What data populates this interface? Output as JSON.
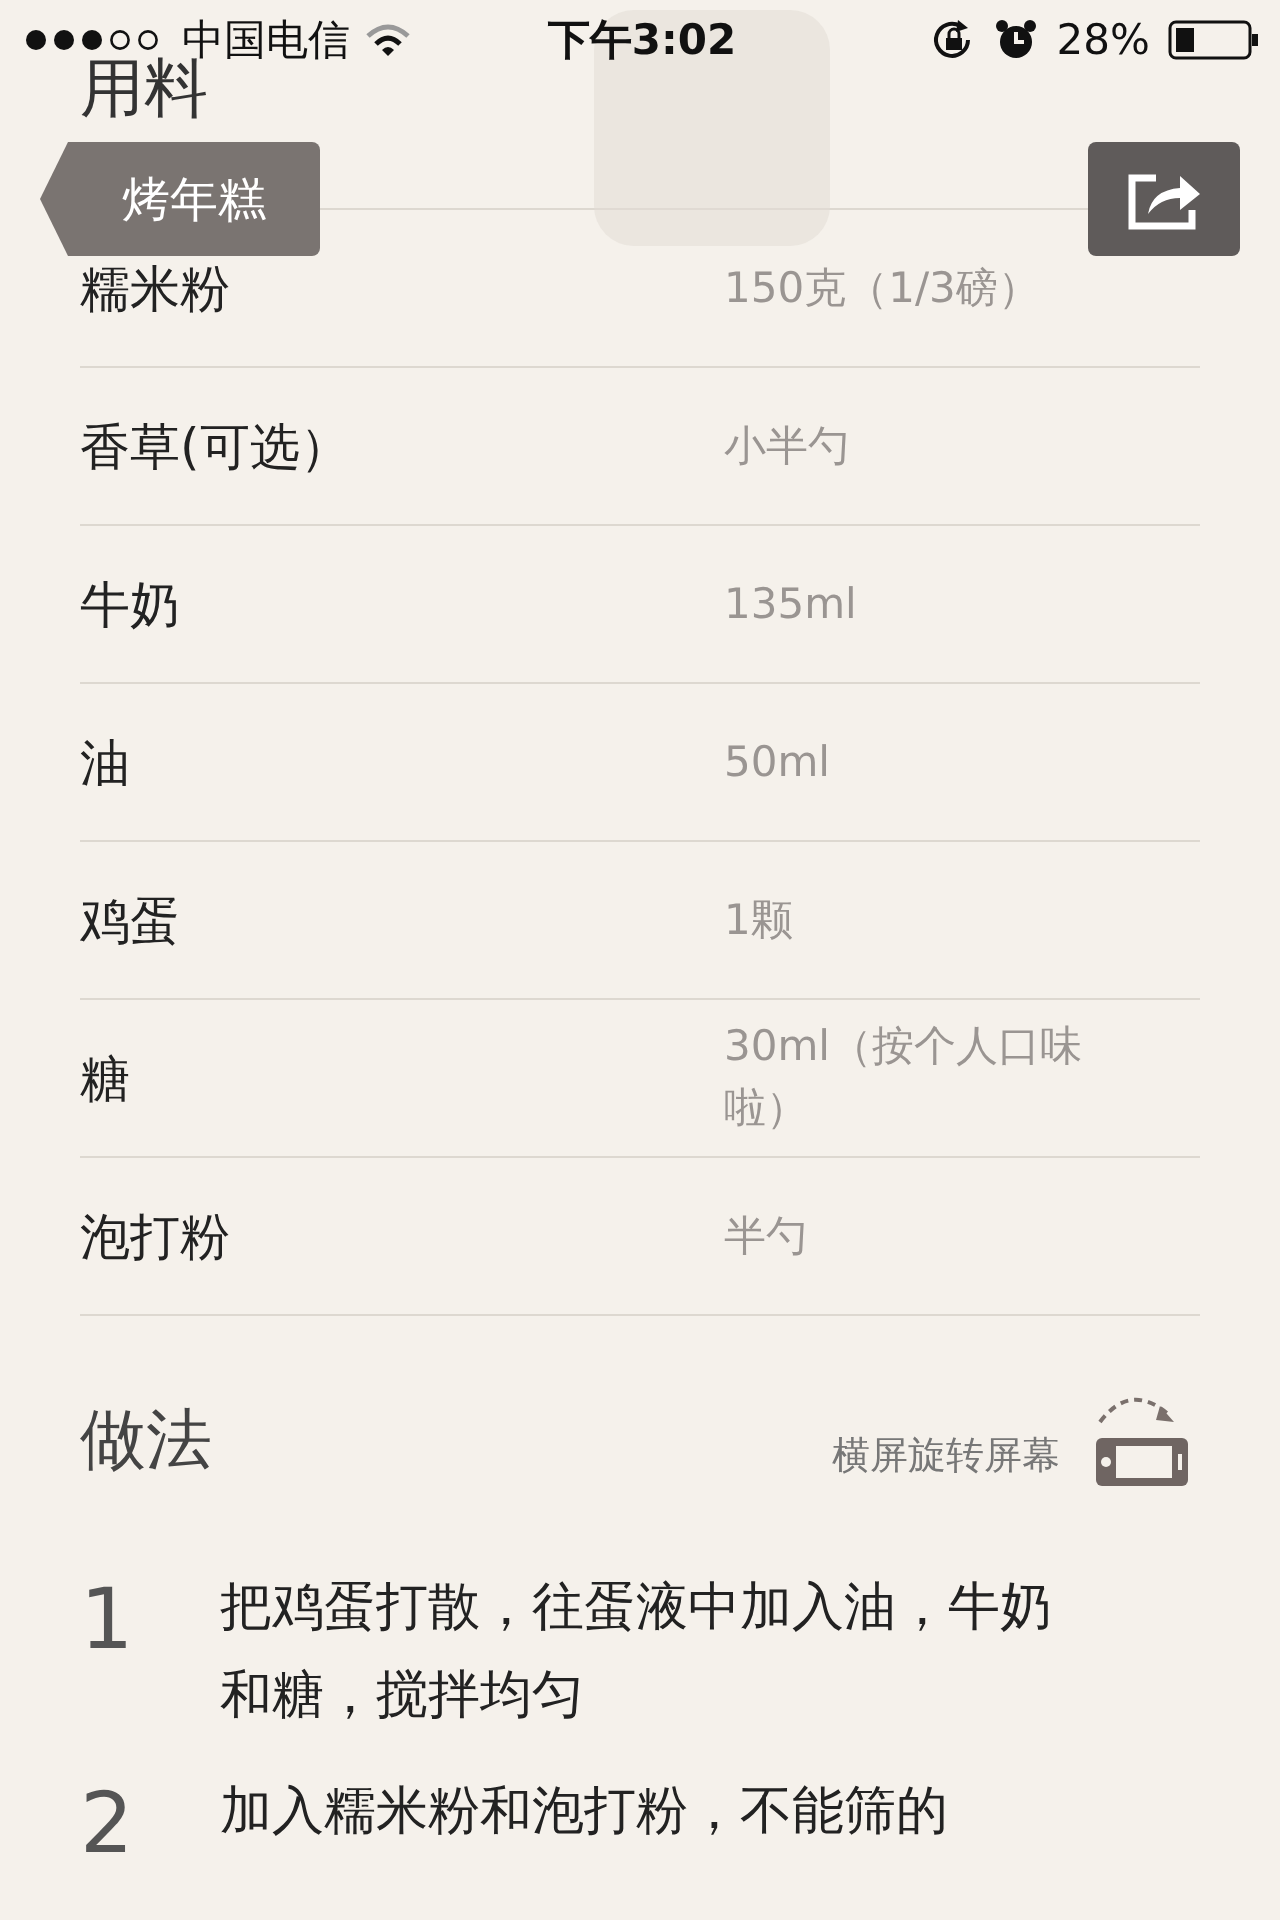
{
  "status_bar": {
    "carrier": "中国电信",
    "time": "下午3:02",
    "battery": "28%"
  },
  "nav": {
    "back": "烤年糕"
  },
  "ingredients": {
    "title": "用料",
    "rows": [
      {
        "name": "糯米粉",
        "amount": "150克（1/3磅）"
      },
      {
        "name": "香草(可选）",
        "amount": "小半勺"
      },
      {
        "name": "牛奶",
        "amount": "135ml"
      },
      {
        "name": "油",
        "amount": "50ml"
      },
      {
        "name": "鸡蛋",
        "amount": "1颗"
      },
      {
        "name": "糖",
        "amount": "30ml（按个人口味啦）"
      },
      {
        "name": "泡打粉",
        "amount": "半勺"
      }
    ]
  },
  "method": {
    "title": "做法",
    "rotate_hint": "横屏旋转屏幕",
    "steps": [
      {
        "number": "1",
        "text": "把鸡蛋打散，往蛋液中加入油，牛奶和糖，搅拌均匀"
      },
      {
        "number": "2",
        "text": "加入糯米粉和泡打粉，不能筛的"
      }
    ]
  }
}
